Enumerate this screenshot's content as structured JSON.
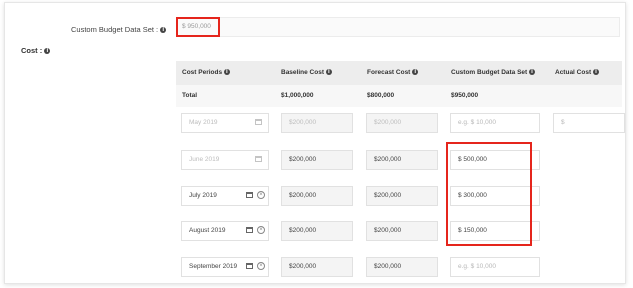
{
  "custom_budget": {
    "label": "Custom Budget Data Set :",
    "value": "$ 950,000"
  },
  "cost_section": {
    "label": "Cost :"
  },
  "table": {
    "headers": [
      "Cost Periods",
      "Baseline Cost",
      "Forecast Cost",
      "Custom Budget Data Set",
      "Actual Cost"
    ],
    "total": {
      "label": "Total",
      "baseline": "$1,000,000",
      "forecast": "$800,000",
      "custom": "$950,000"
    },
    "rows": [
      {
        "period": "May 2019",
        "baseline": "$200,000",
        "forecast": "$200,000",
        "custom_placeholder": "e.g. $ 10,000",
        "actual_placeholder": "$"
      },
      {
        "period": "June 2019",
        "baseline": "$200,000",
        "forecast": "$200,000",
        "custom": "$ 500,000"
      },
      {
        "period": "July 2019",
        "baseline": "$200,000",
        "forecast": "$200,000",
        "custom": "$ 300,000"
      },
      {
        "period": "August 2019",
        "baseline": "$200,000",
        "forecast": "$200,000",
        "custom": "$ 150,000"
      },
      {
        "period": "September 2019",
        "baseline": "$200,000",
        "forecast": "$200,000",
        "custom_placeholder": "e.g. $ 10,000"
      }
    ]
  },
  "colors": {
    "highlight": "#e5251c",
    "header_bg": "#ededed"
  },
  "icons": {
    "info": "info-icon",
    "calendar": "calendar-icon",
    "clear": "clear-circle-icon"
  }
}
